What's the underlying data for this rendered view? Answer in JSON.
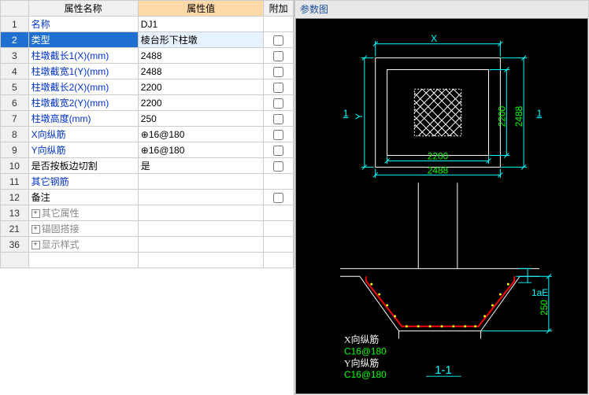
{
  "grid": {
    "headers": {
      "name": "属性名称",
      "value": "属性值",
      "extra": "附加"
    },
    "rows": [
      {
        "n": "1",
        "name": "名称",
        "val": "DJ1",
        "link": true,
        "chk": false
      },
      {
        "n": "2",
        "name": "类型",
        "val": "棱台形下柱墩",
        "sel": true,
        "chk": true
      },
      {
        "n": "3",
        "name": "柱墩截长1(X)(mm)",
        "val": "2488",
        "link": true,
        "chk": true
      },
      {
        "n": "4",
        "name": "柱墩截宽1(Y)(mm)",
        "val": "2488",
        "link": true,
        "chk": true
      },
      {
        "n": "5",
        "name": "柱墩截长2(X)(mm)",
        "val": "2200",
        "link": true,
        "chk": true
      },
      {
        "n": "6",
        "name": "柱墩截宽2(Y)(mm)",
        "val": "2200",
        "link": true,
        "chk": true
      },
      {
        "n": "7",
        "name": "柱墩高度(mm)",
        "val": "250",
        "link": true,
        "chk": true
      },
      {
        "n": "8",
        "name": "X向纵筋",
        "val": "⊕16@180",
        "link": true,
        "chk": true
      },
      {
        "n": "9",
        "name": "Y向纵筋",
        "val": "⊕16@180",
        "link": true,
        "chk": true
      },
      {
        "n": "10",
        "name": "是否按板边切割",
        "val": "是",
        "chk": true
      },
      {
        "n": "11",
        "name": "其它钢筋",
        "val": "",
        "link": true
      },
      {
        "n": "12",
        "name": "备注",
        "val": "",
        "chk": true
      },
      {
        "n": "13",
        "name": "其它属性",
        "val": "",
        "grey": true,
        "plus": true
      },
      {
        "n": "21",
        "name": "锚固搭接",
        "val": "",
        "grey": true,
        "plus": true
      },
      {
        "n": "36",
        "name": "显示样式",
        "val": "",
        "grey": true,
        "plus": true
      },
      {
        "n": "",
        "name": "",
        "val": ""
      }
    ]
  },
  "diagram": {
    "title": "参数图",
    "plan": {
      "outer_w": "2488",
      "inner_w": "2200",
      "outer_h": "2488",
      "inner_h": "2200",
      "x_label": "X",
      "y_label": "Y",
      "cut": "1"
    },
    "section": {
      "anchorage": "1aE",
      "height": "250",
      "cut_label": "1-1",
      "x_rebar_label": "X向纵筋",
      "x_rebar_val": "C16@180",
      "y_rebar_label": "Y向纵筋",
      "y_rebar_val": "C16@180"
    }
  }
}
